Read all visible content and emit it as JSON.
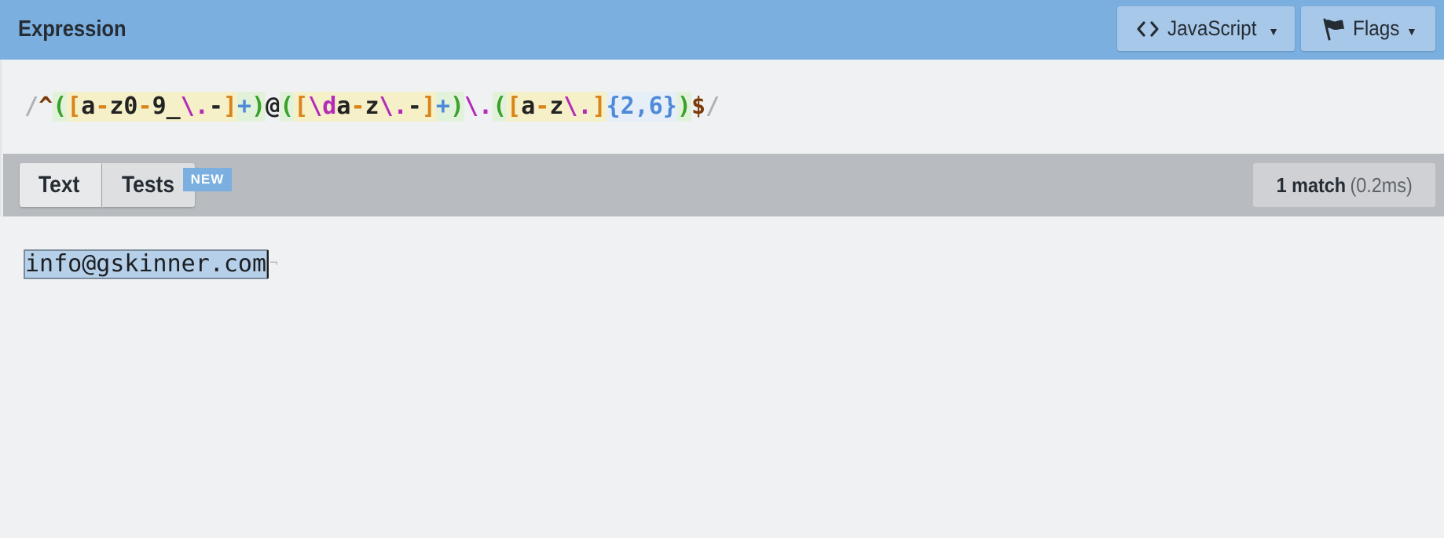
{
  "header": {
    "title": "Expression",
    "flavor_button": {
      "label": "JavaScript",
      "icon": "code-brackets-icon"
    },
    "flags_button": {
      "label": "Flags",
      "icon": "flag-icon"
    }
  },
  "expression": {
    "delimiter_open": "/",
    "delimiter_close": "/",
    "tokens": [
      {
        "text": "^",
        "kind": "anchor"
      },
      {
        "text": "(",
        "kind": "group"
      },
      {
        "text": "[",
        "kind": "set"
      },
      {
        "text": "a",
        "kind": "lit"
      },
      {
        "text": "-",
        "kind": "range"
      },
      {
        "text": "z0",
        "kind": "lit"
      },
      {
        "text": "-",
        "kind": "range"
      },
      {
        "text": "9_",
        "kind": "lit"
      },
      {
        "text": "\\.",
        "kind": "esc"
      },
      {
        "text": "-",
        "kind": "lit"
      },
      {
        "text": "]",
        "kind": "set"
      },
      {
        "text": "+",
        "kind": "quant"
      },
      {
        "text": ")",
        "kind": "group"
      },
      {
        "text": "@",
        "kind": "char"
      },
      {
        "text": "(",
        "kind": "group"
      },
      {
        "text": "[",
        "kind": "set"
      },
      {
        "text": "\\d",
        "kind": "esc"
      },
      {
        "text": "a",
        "kind": "lit"
      },
      {
        "text": "-",
        "kind": "range"
      },
      {
        "text": "z",
        "kind": "lit"
      },
      {
        "text": "\\.",
        "kind": "esc"
      },
      {
        "text": "-",
        "kind": "lit"
      },
      {
        "text": "]",
        "kind": "set"
      },
      {
        "text": "+",
        "kind": "quant"
      },
      {
        "text": ")",
        "kind": "group"
      },
      {
        "text": "\\.",
        "kind": "escp"
      },
      {
        "text": "(",
        "kind": "group"
      },
      {
        "text": "[",
        "kind": "set"
      },
      {
        "text": "a",
        "kind": "lit"
      },
      {
        "text": "-",
        "kind": "range"
      },
      {
        "text": "z",
        "kind": "lit"
      },
      {
        "text": "\\.",
        "kind": "esc"
      },
      {
        "text": "]",
        "kind": "set"
      },
      {
        "text": "{2,6}",
        "kind": "quant-brace"
      },
      {
        "text": ")",
        "kind": "group"
      },
      {
        "text": "$",
        "kind": "anchor"
      }
    ]
  },
  "tabs": {
    "text_label": "Text",
    "tests_label": "Tests",
    "new_badge": "NEW"
  },
  "results": {
    "match_count": "1 match",
    "match_time": "(0.2ms)"
  },
  "test_string": {
    "value": "info@gskinner.com",
    "eol_marker": "¬"
  },
  "colors": {
    "header_bg": "#7aafdf",
    "accent": "#7aafdf",
    "match_highlight": "#b6d0ea"
  }
}
